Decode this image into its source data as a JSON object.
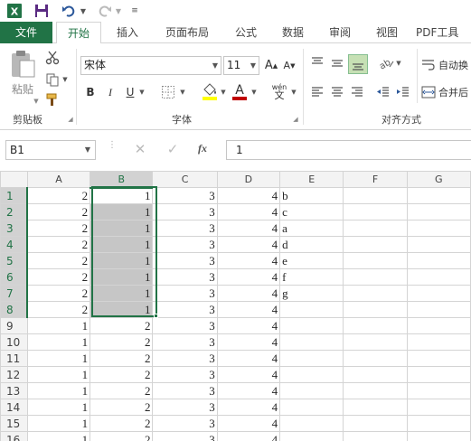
{
  "qat": {
    "excel_icon": "excel-logo-icon",
    "save_icon": "save-icon",
    "undo_icon": "undo-icon",
    "redo_icon": "redo-icon",
    "customize_icon": "customize-qat-icon"
  },
  "tabs": [
    "文件",
    "开始",
    "插入",
    "页面布局",
    "公式",
    "数据",
    "审阅",
    "视图",
    "PDF工具"
  ],
  "active_tab": "开始",
  "ribbon": {
    "clipboard": {
      "paste_label": "粘贴",
      "group_label": "剪贴板"
    },
    "font": {
      "font_name": "宋体",
      "font_size": "11",
      "bold": "B",
      "italic": "I",
      "underline": "U",
      "wen": "wén",
      "group_label": "字体",
      "grow": "A",
      "shrink": "A"
    },
    "alignment": {
      "wrap_label": "自动换",
      "merge_label": "合并后",
      "group_label": "对齐方式"
    }
  },
  "formula_bar": {
    "name_box": "B1",
    "fx": "fx",
    "value": "1"
  },
  "grid": {
    "columns": [
      "A",
      "B",
      "C",
      "D",
      "E",
      "F",
      "G"
    ],
    "rows": [
      {
        "n": "1",
        "a": "2",
        "b": "1",
        "c": "3",
        "d": "4",
        "e": "b"
      },
      {
        "n": "2",
        "a": "2",
        "b": "1",
        "c": "3",
        "d": "4",
        "e": "c"
      },
      {
        "n": "3",
        "a": "2",
        "b": "1",
        "c": "3",
        "d": "4",
        "e": "a"
      },
      {
        "n": "4",
        "a": "2",
        "b": "1",
        "c": "3",
        "d": "4",
        "e": "d"
      },
      {
        "n": "5",
        "a": "2",
        "b": "1",
        "c": "3",
        "d": "4",
        "e": "e"
      },
      {
        "n": "6",
        "a": "2",
        "b": "1",
        "c": "3",
        "d": "4",
        "e": "f"
      },
      {
        "n": "7",
        "a": "2",
        "b": "1",
        "c": "3",
        "d": "4",
        "e": "g"
      },
      {
        "n": "8",
        "a": "2",
        "b": "1",
        "c": "3",
        "d": "4",
        "e": ""
      },
      {
        "n": "9",
        "a": "1",
        "b": "2",
        "c": "3",
        "d": "4",
        "e": ""
      },
      {
        "n": "10",
        "a": "1",
        "b": "2",
        "c": "3",
        "d": "4",
        "e": ""
      },
      {
        "n": "11",
        "a": "1",
        "b": "2",
        "c": "3",
        "d": "4",
        "e": ""
      },
      {
        "n": "12",
        "a": "1",
        "b": "2",
        "c": "3",
        "d": "4",
        "e": ""
      },
      {
        "n": "13",
        "a": "1",
        "b": "2",
        "c": "3",
        "d": "4",
        "e": ""
      },
      {
        "n": "14",
        "a": "1",
        "b": "2",
        "c": "3",
        "d": "4",
        "e": ""
      },
      {
        "n": "15",
        "a": "1",
        "b": "2",
        "c": "3",
        "d": "4",
        "e": ""
      },
      {
        "n": "16",
        "a": "1",
        "b": "2",
        "c": "3",
        "d": "4",
        "e": ""
      }
    ]
  },
  "colors": {
    "accent": "#217346",
    "selection": "#c6c6c6"
  }
}
